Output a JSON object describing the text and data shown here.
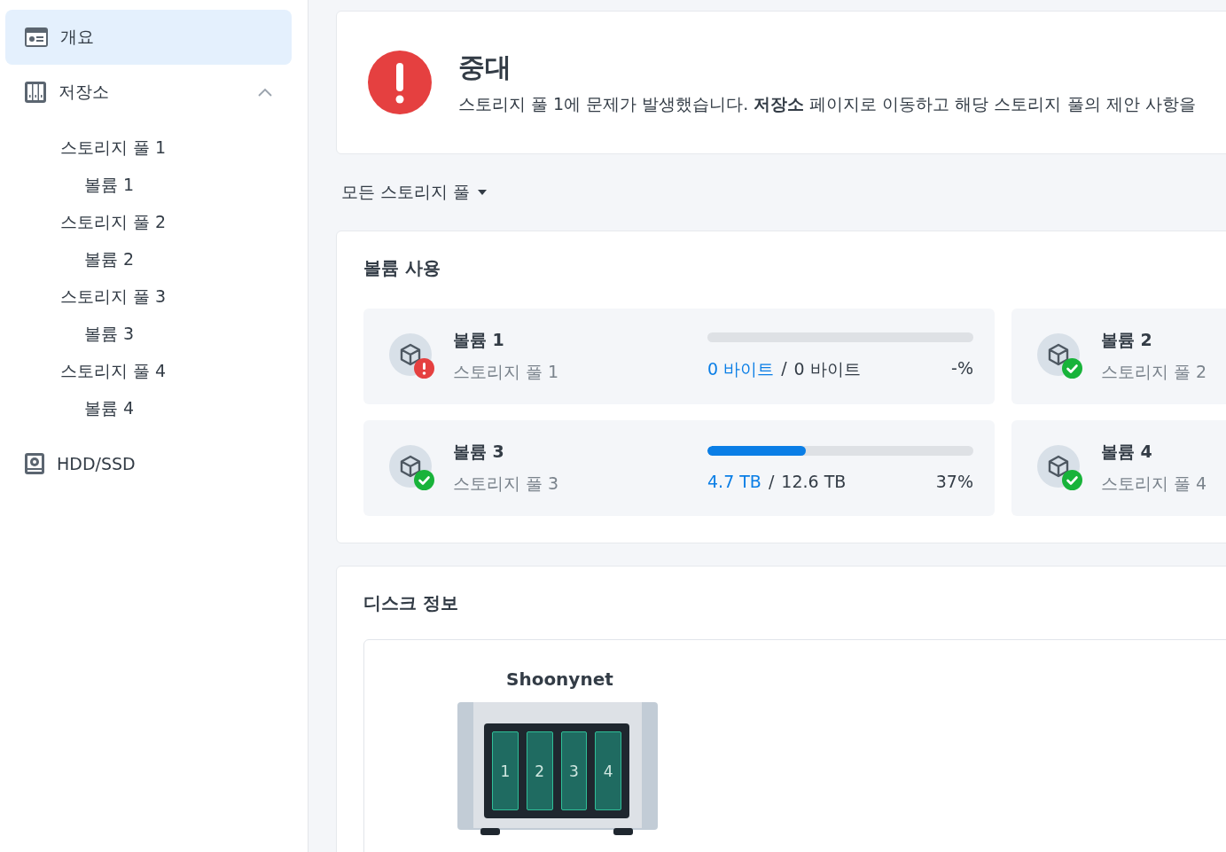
{
  "sidebar": {
    "items": [
      {
        "label": "개요",
        "selected": true
      },
      {
        "label": "저장소",
        "selected": false,
        "expanded": true,
        "children": [
          {
            "label": "스토리지 풀 1",
            "selected": false,
            "children": [
              {
                "label": "볼륨 1",
                "selected": false
              }
            ]
          },
          {
            "label": "스토리지 풀 2",
            "selected": false,
            "children": [
              {
                "label": "볼륨 2",
                "selected": false
              }
            ]
          },
          {
            "label": "스토리지 풀 3",
            "selected": false,
            "children": [
              {
                "label": "볼륨 3",
                "selected": false
              }
            ]
          },
          {
            "label": "스토리지 풀 4",
            "selected": false,
            "children": [
              {
                "label": "볼륨 4",
                "selected": false
              }
            ]
          }
        ]
      },
      {
        "label": "HDD/SSD",
        "selected": false
      }
    ]
  },
  "alert": {
    "kind": "critical",
    "title": "중대",
    "message": "스토리지 풀 1에 문제가 발생했습니다. **저장소** 페이지로 이동하고 해당 스토리지 풀의 제안 사항을"
  },
  "pool_filter": {
    "value": "모든 스토리지 풀"
  },
  "volume_usage": {
    "title": "볼륨 사용",
    "volumes": [
      {
        "name": "볼륨 1",
        "pool": "스토리지 풀 1",
        "error": true,
        "level": 0,
        "used": "0 바이트",
        "separator": "/",
        "total": "0 바이트",
        "percent": "-%"
      },
      {
        "name": "볼륨 2",
        "pool": "스토리지 풀 2",
        "error": false
      },
      {
        "name": "볼륨 3",
        "pool": "스토리지 풀 3",
        "error": false,
        "level": 0.37,
        "used": "4.7 TB",
        "separator": "/",
        "total": "12.6 TB",
        "percent": "37%"
      },
      {
        "name": "볼륨 4",
        "pool": "스토리지 풀 4",
        "error": false
      }
    ]
  },
  "disk_info": {
    "title": "디스크 정보",
    "device": "Shoonynet",
    "bays": [
      "1",
      "2",
      "3",
      "4"
    ]
  }
}
